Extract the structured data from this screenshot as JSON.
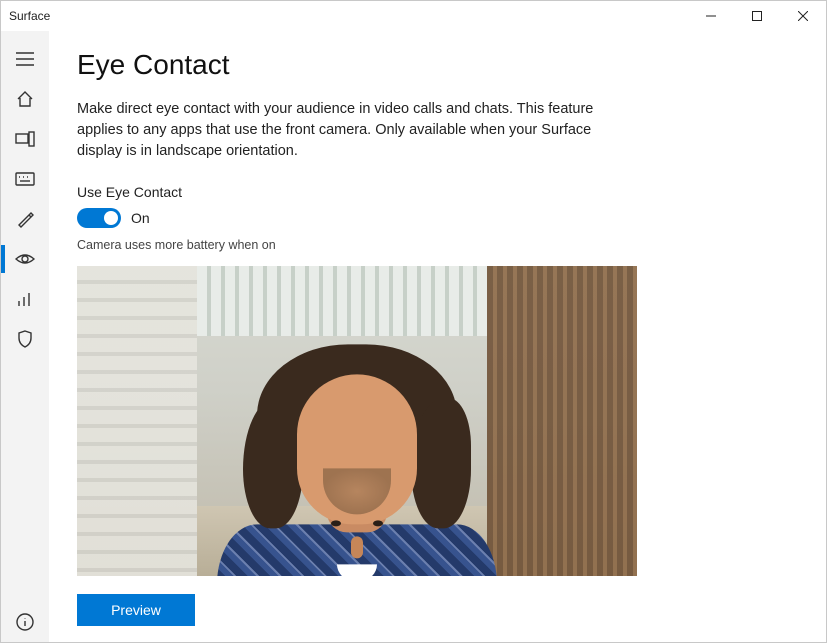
{
  "window": {
    "title": "Surface"
  },
  "sidebar": {
    "items": [
      {
        "name": "menu"
      },
      {
        "name": "home"
      },
      {
        "name": "devices"
      },
      {
        "name": "keyboard"
      },
      {
        "name": "pen"
      },
      {
        "name": "eye-contact",
        "selected": true
      },
      {
        "name": "signal"
      },
      {
        "name": "security"
      }
    ],
    "footer": {
      "name": "info"
    }
  },
  "page": {
    "title": "Eye Contact",
    "description": "Make direct eye contact with your audience in video calls and chats. This feature applies to any apps that use the front camera. Only available when your Surface display is in landscape orientation.",
    "toggle": {
      "label": "Use Eye Contact",
      "state": "On",
      "on": true
    },
    "hint": "Camera uses more battery when on",
    "preview_alt": "Camera preview showing a smiling man with curly hair in a plaid shirt inside a modern building atrium",
    "preview_button": "Preview"
  }
}
